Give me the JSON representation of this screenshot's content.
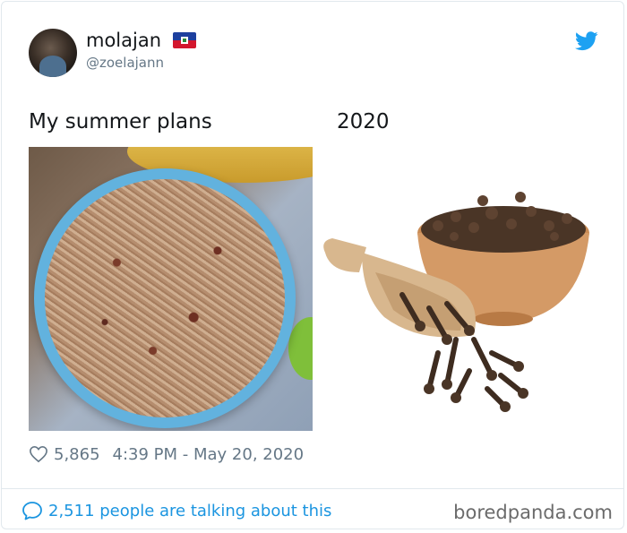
{
  "user": {
    "name": "molajan",
    "handle": "@zoelajann",
    "flag": "haiti-flag-icon"
  },
  "tweet": {
    "caption_left": "My summer plans",
    "caption_right": "2020",
    "images": [
      {
        "subject": "rice-and-beans-bowl"
      },
      {
        "subject": "cloves-bowl-and-scoop"
      }
    ],
    "likes": "5,865",
    "timestamp": "4:39 PM - May 20, 2020"
  },
  "footer": {
    "talking": "2,511 people are talking about this",
    "watermark": "boredpanda.com"
  },
  "colors": {
    "twitter_blue": "#1da1f2",
    "link_blue": "#1b95e0",
    "muted_gray": "#657786"
  }
}
